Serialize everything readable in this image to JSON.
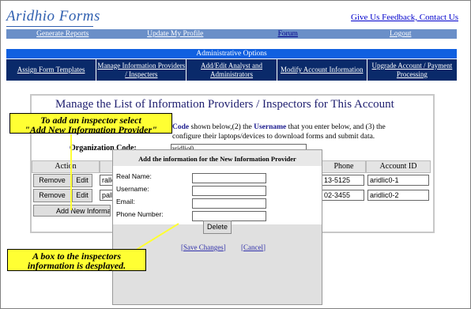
{
  "app": {
    "logo": "Aridhio Forms",
    "feedback_link": "Give Us Feedback, Contact Us"
  },
  "topnav": [
    {
      "label": "Generate Reports"
    },
    {
      "label": "Update My Profile"
    },
    {
      "label": "Forum"
    },
    {
      "label": "Logout"
    }
  ],
  "admin": {
    "title": "Administrative Options",
    "items": [
      {
        "label": "Assign Form Templates"
      },
      {
        "label": "Manage Information Providers / Inspecters"
      },
      {
        "label": "Add/Edit Analyst and Administrators"
      },
      {
        "label": "Modify Account Information"
      },
      {
        "label": "Upgrade Account / Payment Processing"
      }
    ]
  },
  "main": {
    "title": "Manage the List of Information Providers / Inspectors for This Account",
    "instructions": {
      "part1": "Code",
      "part2": " shown below,(2) the ",
      "part3": "Username",
      "part4": " that you enter below, and (3) the",
      "line2": "configure their laptops/devices to download forms and submit data."
    },
    "org_label": "Organization Code:",
    "org_value": "aridlio0",
    "columns": {
      "action": "Action",
      "phone": "Phone",
      "account_id": "Account ID"
    },
    "rows": [
      {
        "username": "ralle",
        "phone": "13-5125",
        "account_id": "aridlic0-1"
      },
      {
        "username": "pall",
        "phone": "02-3455",
        "account_id": "aridlic0-2"
      }
    ],
    "remove_label": "Remove",
    "edit_label": "Edit",
    "add_label": "Add New Informati"
  },
  "dialog": {
    "title": "Add the information for the New Information Provider",
    "fields": [
      {
        "label": "Real Name:"
      },
      {
        "label": "Username:"
      },
      {
        "label": "Email:"
      },
      {
        "label": "Phone Number:"
      }
    ],
    "delete_label": "Delete",
    "save_label": "Save Changes",
    "cancel_label": "Cancel"
  },
  "callouts": {
    "top_line1": "To add an inspector select",
    "top_line2": "\"Add New Information Provider\"",
    "bottom_line1": "A box to the inspectors",
    "bottom_line2": "information is desplayed."
  },
  "colors": {
    "callout": "#ffff33",
    "nav": "#6a8fc8",
    "admin_bar": "#0a2a6a",
    "admin_title": "#1060e0"
  }
}
